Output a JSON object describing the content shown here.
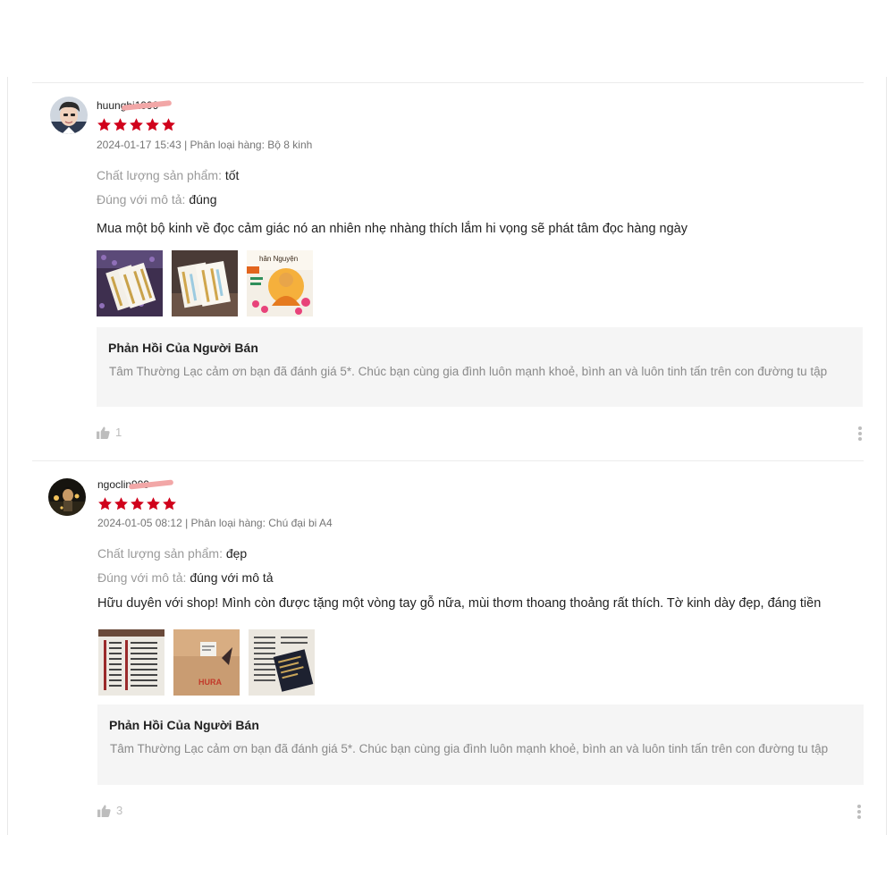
{
  "reviews": [
    {
      "username": "huunghi1999",
      "rating": 5,
      "meta": "2024-01-17 15:43 | Phân loại hàng: Bộ 8 kinh",
      "quality_label": "Chất lượng sản phẩm:",
      "quality_value": "tốt",
      "match_label": "Đúng với mô tả:",
      "match_value": "đúng",
      "comment": "Mua một bộ kinh về đọc cảm giác nó an nhiên nhẹ nhàng thích lắm hi vọng sẽ phát tâm đọc hàng ngày",
      "images": [
        "lavender-books-photo",
        "lavender-books-photo-2",
        "buddha-poster-photo"
      ],
      "image_caption_fragment": "hân Nguyện",
      "seller_reply": {
        "title": "Phản Hồi Của Người Bán",
        "text": "Tâm Thường Lạc cảm ơn bạn đã đánh giá 5*. Chúc bạn cùng gia đình luôn mạnh khoẻ, bình an và luôn tinh tấn trên con đường tu tập"
      },
      "likes": "1"
    },
    {
      "username": "ngoclin999",
      "rating": 5,
      "meta": "2024-01-05 08:12 | Phân loại hàng: Chú đại bi A4",
      "quality_label": "Chất lượng sản phẩm:",
      "quality_value": "đẹp",
      "match_label": "Đúng với mô tả:",
      "match_value": "đúng với mô tả",
      "comment": "Hữu duyên với shop! Mình còn được tặng một vòng tay gỗ nữa, mùi thơm thoang thoảng rất thích. Tờ kinh dày đẹp, đáng tiền",
      "images": [
        "sutra-sheet-photo",
        "package-box-photo",
        "sutra-sheet-card-photo"
      ],
      "image_caption_fragment": "HURA",
      "seller_reply": {
        "title": "Phản Hồi Của Người Bán",
        "text": "Tâm Thường Lạc cảm ơn bạn đã đánh giá 5*. Chúc bạn cùng gia đình luôn mạnh khoẻ, bình an và luôn tinh tấn trên con đường tu tập"
      },
      "likes": "3"
    }
  ],
  "colors": {
    "star": "#d0011b",
    "reply_bg": "#f5f5f5",
    "muted": "#757575",
    "divider": "#ececec"
  },
  "icons": [
    "star-icon",
    "thumbs-up-icon",
    "more-options-icon"
  ]
}
